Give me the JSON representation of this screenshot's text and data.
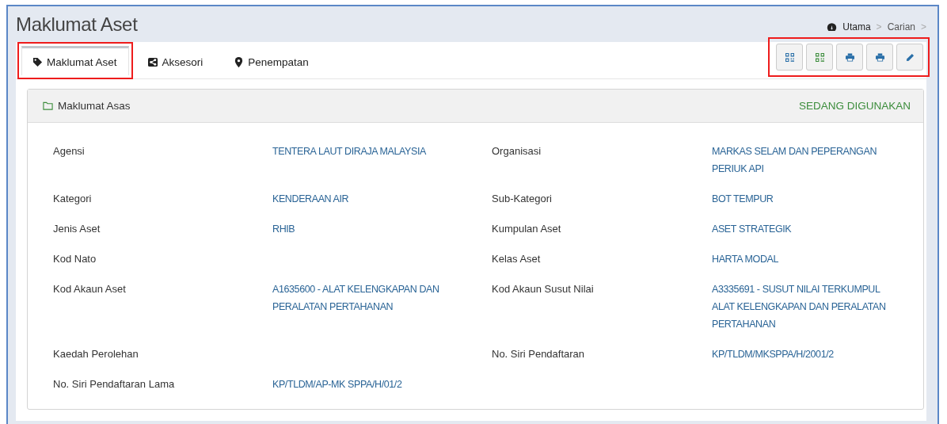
{
  "page_title": "Maklumat Aset",
  "breadcrumb": [
    {
      "kind": "home",
      "text": "Utama"
    },
    {
      "kind": "separator",
      "text": ">"
    },
    {
      "kind": "link",
      "text": "Carian"
    },
    {
      "kind": "separator",
      "text": ">"
    }
  ],
  "tabs": [
    {
      "label": "Maklumat Aset",
      "kind": "tag",
      "selected": true,
      "highlighted": true
    },
    {
      "label": "Aksesori",
      "kind": "share",
      "selected": false,
      "highlighted": false
    },
    {
      "label": "Penempatan",
      "kind": "marker",
      "selected": false,
      "highlighted": false
    }
  ],
  "toolbar": {
    "highlighted": true,
    "buttons": [
      {
        "kind": "qr",
        "color": "#2a6fa8"
      },
      {
        "kind": "qr",
        "color": "#3c8d3c"
      },
      {
        "kind": "print",
        "color": "#2a6fa8"
      },
      {
        "kind": "print",
        "color": "#2a6fa8"
      },
      {
        "kind": "edit",
        "color": "#2a6fa8"
      }
    ]
  },
  "panel": {
    "title": "Maklumat Asas",
    "status": "SEDANG DIGUNAKAN",
    "fields": [
      {
        "label": "Agensi",
        "value": "TENTERA LAUT DIRAJA MALAYSIA"
      },
      {
        "label": "Organisasi",
        "value": "MARKAS SELAM DAN PEPERANGAN PERIUK API"
      },
      {
        "label": "Kategori",
        "value": "KENDERAAN AIR"
      },
      {
        "label": "Sub-Kategori",
        "value": "BOT TEMPUR"
      },
      {
        "label": "Jenis Aset",
        "value": "RHIB"
      },
      {
        "label": "Kumpulan Aset",
        "value": "ASET STRATEGIK"
      },
      {
        "label": "Kod Nato"
      },
      {
        "label": "Kelas Aset",
        "value": "HARTA MODAL"
      },
      {
        "label": "Kod Akaun Aset",
        "value": "A1635600 - ALAT KELENGKAPAN DAN PERALATAN PERTAHANAN"
      },
      {
        "label": "Kod Akaun Susut Nilai",
        "value": "A3335691 - SUSUT NILAI TERKUMPUL ALAT KELENGKAPAN DAN PERALATAN PERTAHANAN"
      },
      {
        "label": "Kaedah Perolehan"
      },
      {
        "label": "No. Siri Pendaftaran",
        "value": "KP/TLDM/MKSPPA/H/2001/2"
      },
      {
        "label": "No. Siri Pendaftaran Lama",
        "value": "KP/TLDM/AP-MK SPPA/H/01/2"
      }
    ]
  }
}
